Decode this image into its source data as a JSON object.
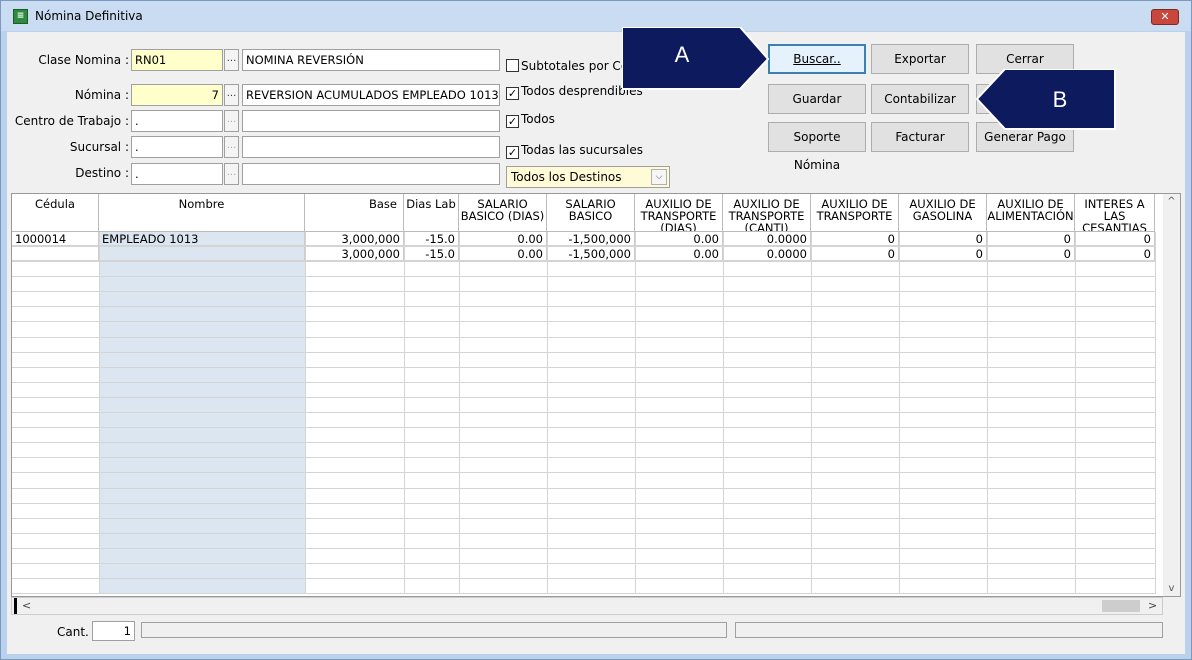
{
  "window": {
    "title": "Nómina Definitiva",
    "icon": "spreadsheet-icon",
    "close_symbol": "✕"
  },
  "form": {
    "clase_nomina": {
      "label": "Clase Nomina :",
      "code": "RN01",
      "desc": "NOMINA REVERSIÓN"
    },
    "nomina": {
      "label": "Nómina :",
      "code": "7",
      "desc": "REVERSION ACUMULADOS EMPLEADO 1013:"
    },
    "centro_trabajo": {
      "label": "Centro de Trabajo :",
      "code": ".",
      "desc": ""
    },
    "sucursal": {
      "label": "Sucursal :",
      "code": ".",
      "desc": ""
    },
    "destino": {
      "label": "Destino :",
      "code": ".",
      "desc": ""
    },
    "lookup_symbol": "..."
  },
  "checkboxes": [
    {
      "label": "Subtotales por Ce",
      "checked": false
    },
    {
      "label": "Todos desprendibles",
      "checked": true
    },
    {
      "label": "Todos",
      "checked": true
    },
    {
      "label": "Todas las sucursales",
      "checked": true
    }
  ],
  "destinos_select": {
    "value": "Todos los Destinos"
  },
  "buttons": {
    "buscar": "Buscar..",
    "exportar": "Exportar",
    "cerrar": "Cerrar",
    "guardar": "Guardar",
    "contabilizar": "Contabilizar",
    "soporte": "Soporte Nómina",
    "facturar": "Facturar",
    "generar_pago": "Generar Pago"
  },
  "grid": {
    "columns": [
      "Cédula",
      "Nombre",
      "Base",
      "Dias Lab",
      "SALARIO BASICO (DIAS)",
      "SALARIO BASICO",
      "AUXILIO DE TRANSPORTE (DIAS)",
      "AUXILIO DE TRANSPORTE (CANTI)",
      "AUXILIO DE TRANSPORTE",
      "AUXILIO DE GASOLINA",
      "AUXILIO DE ALIMENTACIÓN",
      "INTERES A LAS CESANTIAS"
    ],
    "rows": [
      [
        "1000014",
        "EMPLEADO 1013",
        "3,000,000",
        "-15.0",
        "0.00",
        "-1,500,000",
        "0.00",
        "0.0000",
        "0",
        "0",
        "0",
        "0"
      ],
      [
        "",
        "",
        "3,000,000",
        "-15.0",
        "0.00",
        "-1,500,000",
        "0.00",
        "0.0000",
        "0",
        "0",
        "0",
        "0"
      ]
    ]
  },
  "status": {
    "cant_label": "Cant.",
    "cant_value": "1"
  },
  "annotations": {
    "a": "A",
    "b": "B"
  },
  "scroll_glyphs": {
    "up": "^",
    "down": "v",
    "left": "<",
    "right": ">"
  }
}
